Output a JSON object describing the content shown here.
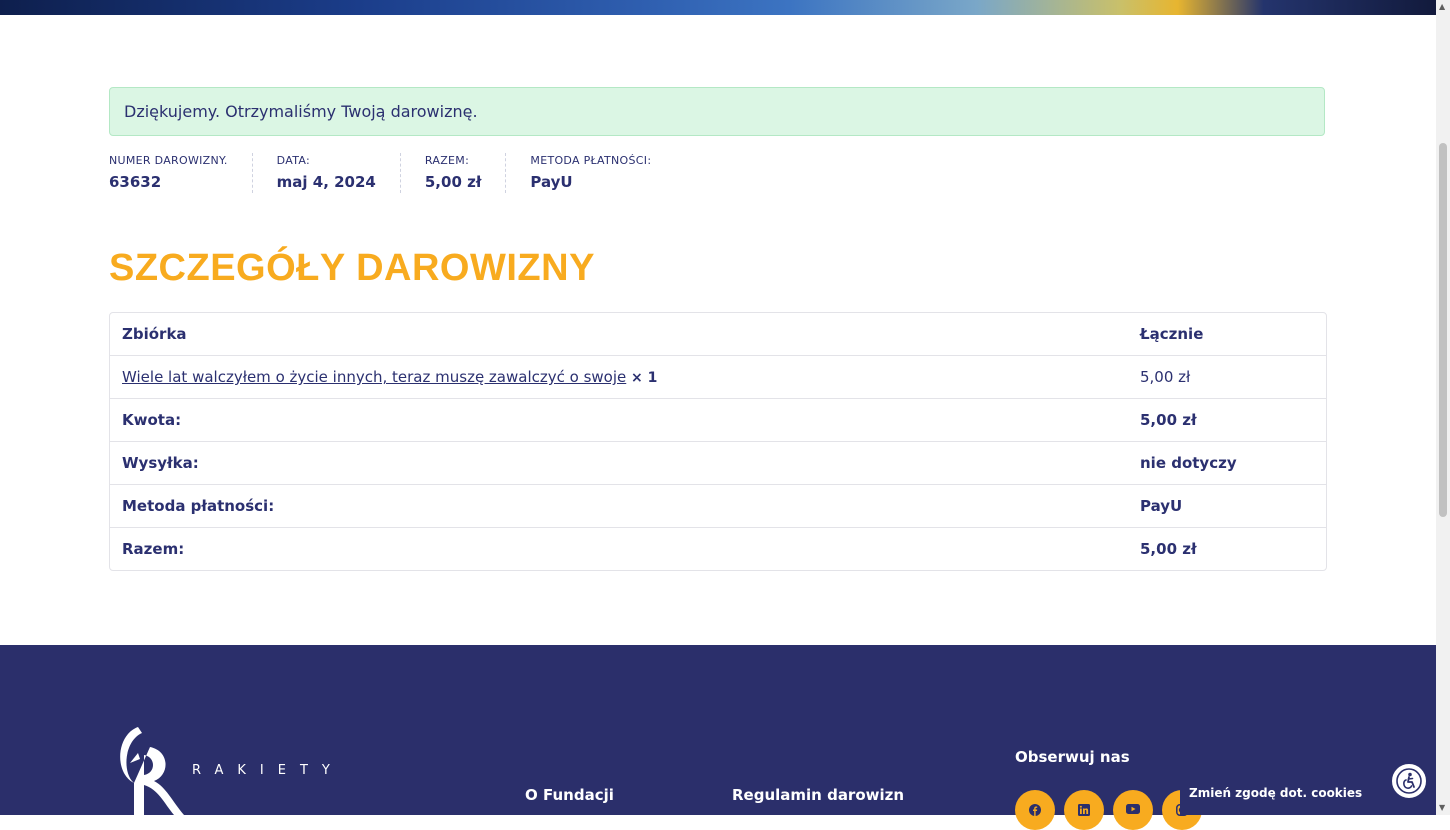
{
  "notice": "Dziękujemy. Otrzymaliśmy Twoją darowiznę.",
  "overview": [
    {
      "label": "Numer darowizny.",
      "value": "63632"
    },
    {
      "label": "Data:",
      "value": "maj 4, 2024"
    },
    {
      "label": "Razem:",
      "value": "5,00 zł"
    },
    {
      "label": "Metoda płatności:",
      "value": "PayU"
    }
  ],
  "heading": "SZCZEGÓŁY DAROWIZNY",
  "table": {
    "col1": "Zbiórka",
    "col2": "Łącznie",
    "item_name": "Wiele lat walczyłem o życie innych, teraz muszę zawalczyć o swoje",
    "item_qty": "× 1",
    "item_total": "5,00 zł",
    "rows": [
      {
        "label": "Kwota:",
        "value": "5,00 zł"
      },
      {
        "label": "Wysyłka:",
        "value": "nie dotyczy"
      },
      {
        "label": "Metoda płatności:",
        "value": "PayU"
      },
      {
        "label": "Razem:",
        "value": "5,00 zł"
      }
    ]
  },
  "footer": {
    "brand": "RAKIETY",
    "link_foundation": "O Fundacji",
    "link_terms": "Regulamin darowizn",
    "follow": "Obserwuj nas",
    "social": [
      "facebook-icon",
      "linkedin-icon",
      "youtube-icon",
      "instagram-icon"
    ],
    "cookie": "Zmień zgodę dot. cookies"
  },
  "colors": {
    "accent": "#f8ab1f",
    "navy": "#2b2f6b",
    "success_bg": "#dbf6e4"
  }
}
